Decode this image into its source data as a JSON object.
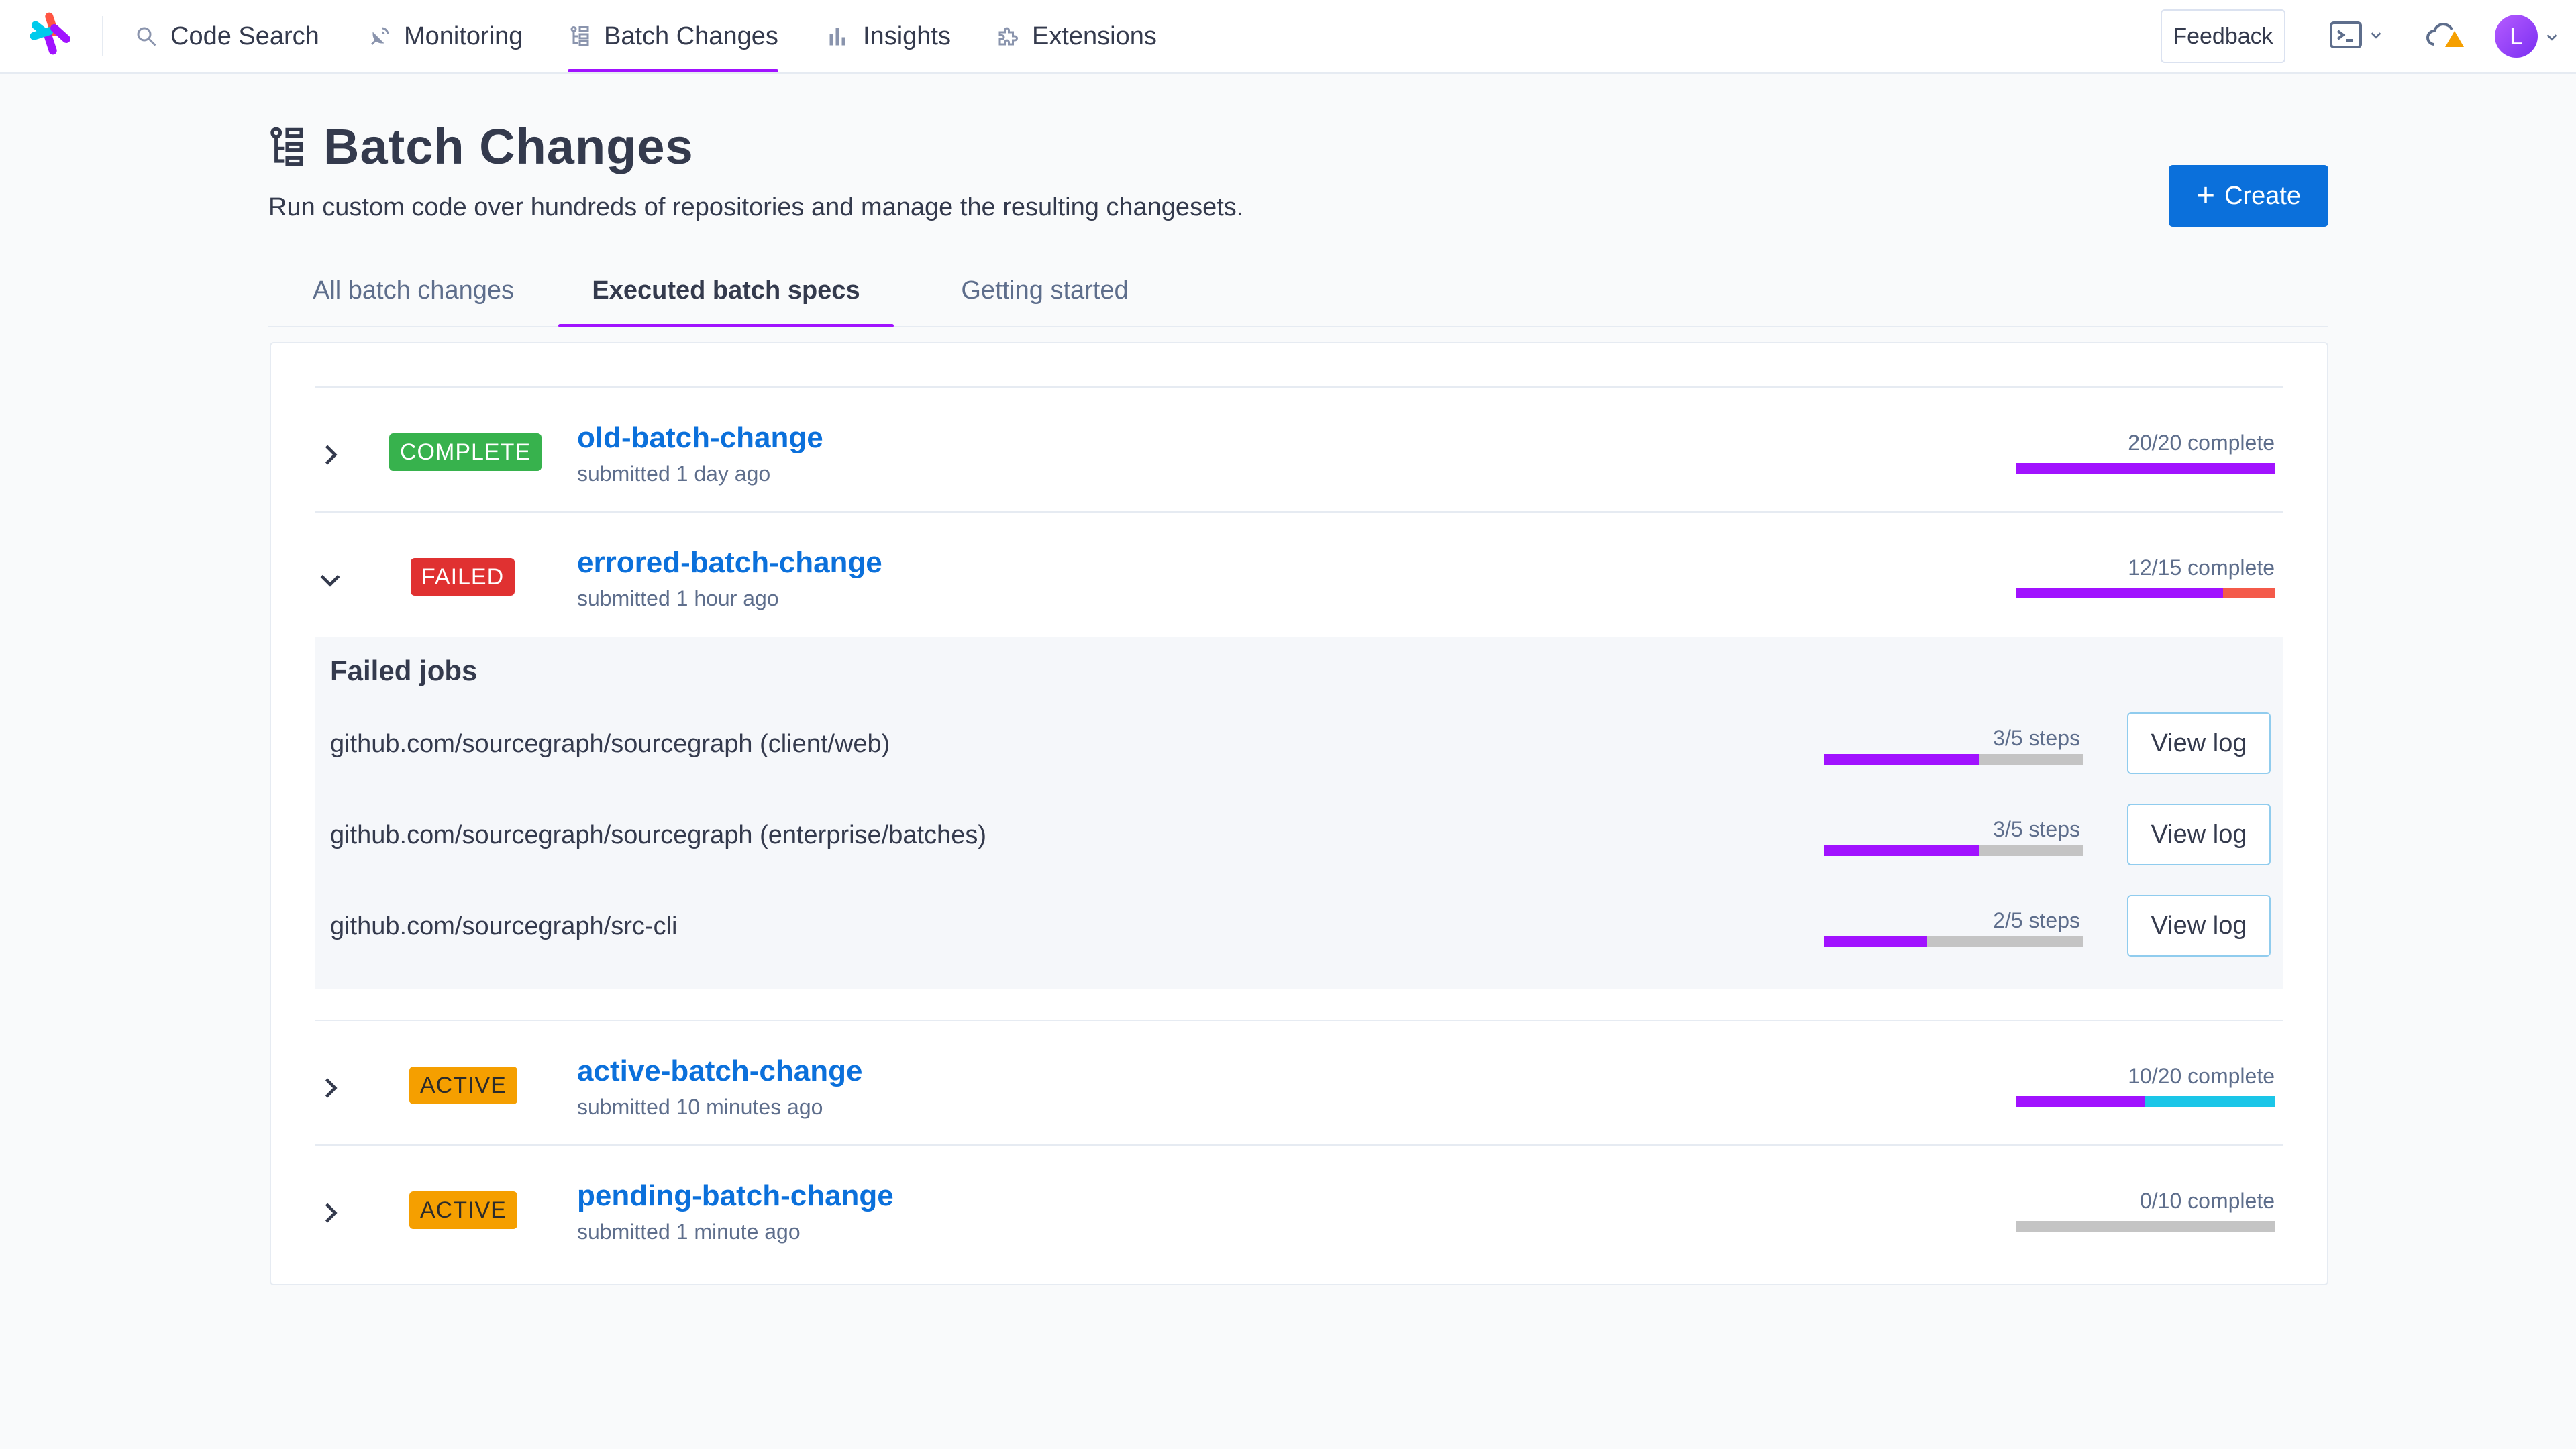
{
  "nav": {
    "items": [
      {
        "label": "Code Search",
        "icon": "search-icon"
      },
      {
        "label": "Monitoring",
        "icon": "monitoring-icon"
      },
      {
        "label": "Batch Changes",
        "icon": "batch-changes-icon",
        "active": true
      },
      {
        "label": "Insights",
        "icon": "insights-icon"
      },
      {
        "label": "Extensions",
        "icon": "extensions-icon"
      }
    ],
    "feedback_label": "Feedback",
    "avatar_initial": "L"
  },
  "header": {
    "title": "Batch Changes",
    "subtitle": "Run custom code over hundreds of repositories and manage the resulting changesets.",
    "create_label": "Create"
  },
  "tabs": [
    {
      "label": "All batch changes"
    },
    {
      "label": "Executed batch specs",
      "active": true
    },
    {
      "label": "Getting started"
    }
  ],
  "specs": [
    {
      "state": "COMPLETE",
      "name": "old-batch-change",
      "submitted": "submitted 1 day ago",
      "progress": "20/20 complete",
      "completed": 20,
      "failed": 0,
      "processing": 0,
      "total": 20,
      "expanded": false
    },
    {
      "state": "FAILED",
      "name": "errored-batch-change",
      "submitted": "submitted 1 hour ago",
      "progress": "12/15 complete",
      "completed": 12,
      "failed": 3,
      "processing": 0,
      "total": 15,
      "expanded": true
    },
    {
      "state": "ACTIVE",
      "name": "active-batch-change",
      "submitted": "submitted 10 minutes ago",
      "progress": "10/20 complete",
      "completed": 10,
      "failed": 0,
      "processing": 10,
      "total": 20,
      "expanded": false
    },
    {
      "state": "ACTIVE",
      "name": "pending-batch-change",
      "submitted": "submitted 1 minute ago",
      "progress": "0/10 complete",
      "completed": 0,
      "failed": 0,
      "processing": 0,
      "total": 10,
      "expanded": false
    }
  ],
  "failed_jobs": {
    "title": "Failed jobs",
    "view_log_label": "View log",
    "jobs": [
      {
        "repo": "github.com/sourcegraph/sourcegraph (client/web)",
        "steps": "3/5 steps",
        "done": 3,
        "total": 5
      },
      {
        "repo": "github.com/sourcegraph/sourcegraph (enterprise/batches)",
        "steps": "3/5 steps",
        "done": 3,
        "total": 5
      },
      {
        "repo": "github.com/sourcegraph/src-cli",
        "steps": "2/5 steps",
        "done": 2,
        "total": 5
      }
    ]
  },
  "colors": {
    "accent": "#a112ff",
    "link": "#0b70db",
    "complete": "#37b24d",
    "failed": "#e03131",
    "failed_bar": "#f45a4a",
    "active": "#f59f00",
    "processing_bar": "#1bc6e8",
    "pending_bar": "#c4c4c4"
  }
}
